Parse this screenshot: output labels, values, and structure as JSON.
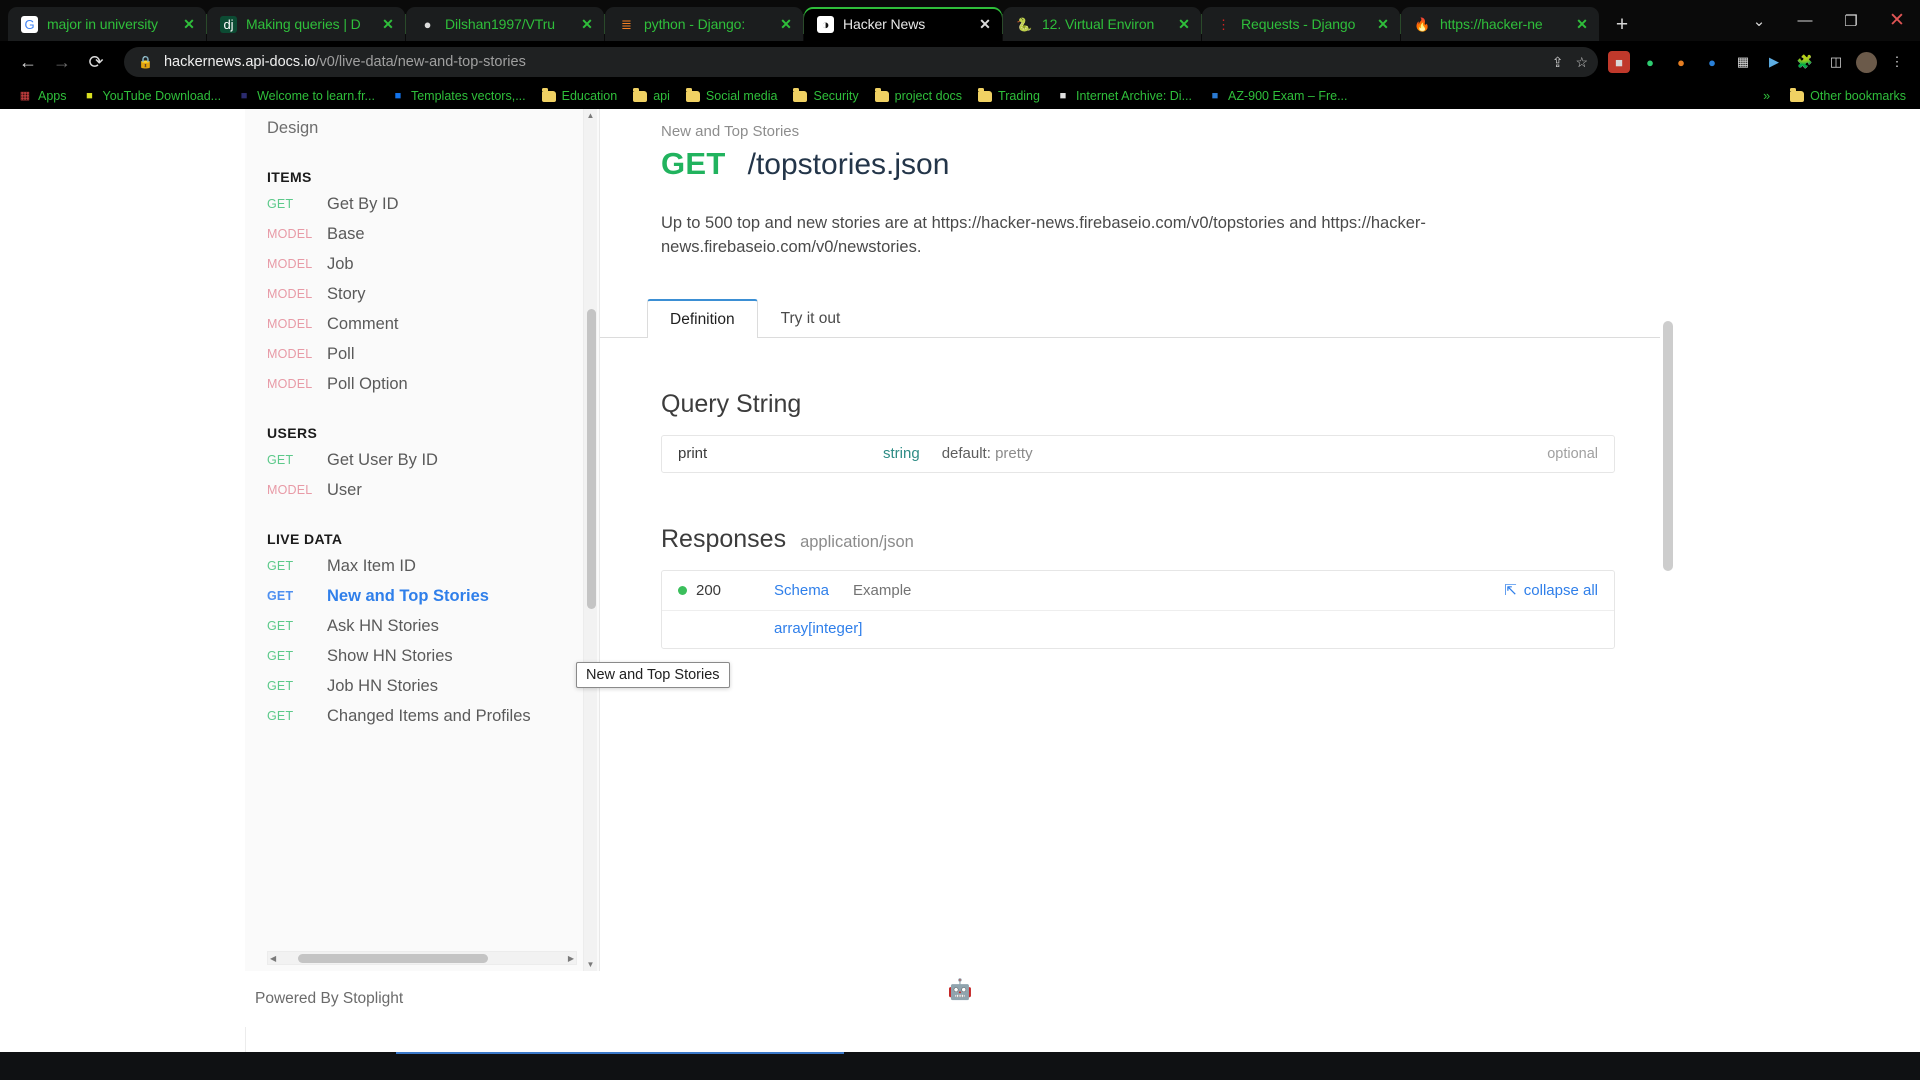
{
  "browser": {
    "tabs": [
      {
        "title": "major in university",
        "icon": "google-icon",
        "glyph": "G",
        "active": false
      },
      {
        "title": "Making queries | D",
        "icon": "django-icon",
        "glyph": "dj",
        "active": false
      },
      {
        "title": "Dilshan1997/VTru",
        "icon": "github-icon",
        "glyph": "●",
        "active": false
      },
      {
        "title": "python - Django:",
        "icon": "stackoverflow-icon",
        "glyph": "≣",
        "active": false
      },
      {
        "title": "Hacker News",
        "icon": "hackernews-icon",
        "glyph": "◑",
        "active": true
      },
      {
        "title": "12. Virtual Environ",
        "icon": "python-icon",
        "glyph": "🐍",
        "active": false
      },
      {
        "title": "Requests - Django",
        "icon": "dots-icon",
        "glyph": "⋮",
        "active": false
      },
      {
        "title": "https://hacker-ne",
        "icon": "firebase-icon",
        "glyph": "🔥",
        "active": false
      }
    ],
    "new_tab_label": "+",
    "window_controls": {
      "more": "⌄",
      "minimize": "—",
      "maximize": "❐",
      "close": "✕"
    },
    "nav": {
      "back": "←",
      "forward": "→",
      "reload": "⟳"
    },
    "omnibox": {
      "lock_icon": "lock-icon",
      "url_domain": "hackernews.api-docs.io",
      "url_path": "/v0/live-data/new-and-top-stories",
      "share_icon": "share-icon",
      "star_icon": "star-icon"
    },
    "toolbar_icons": [
      "extension-red-icon",
      "shield-green-icon",
      "orange-circle-icon",
      "blue-circle-icon",
      "qr-icon",
      "video-icon",
      "puzzle-icon",
      "sidebar-icon",
      "profile-avatar",
      "menu-icon"
    ],
    "bookmarks": {
      "apps_label": "Apps",
      "items": [
        {
          "label": "YouTube Download...",
          "icon": "youtube-icon"
        },
        {
          "label": "Welcome to learn.fr...",
          "icon": "code-icon"
        },
        {
          "label": "Templates vectors,...",
          "icon": "freepik-icon"
        },
        {
          "label": "Education",
          "icon": "folder-icon"
        },
        {
          "label": "api",
          "icon": "folder-icon"
        },
        {
          "label": "Social media",
          "icon": "folder-icon"
        },
        {
          "label": "Security",
          "icon": "folder-icon"
        },
        {
          "label": "project docs",
          "icon": "folder-icon"
        },
        {
          "label": "Trading",
          "icon": "folder-icon"
        },
        {
          "label": "Internet Archive: Di...",
          "icon": "archive-icon"
        },
        {
          "label": "AZ-900 Exam – Fre...",
          "icon": "blue-lines-icon"
        }
      ],
      "overflow_label": "»",
      "other_bookmarks_label": "Other bookmarks"
    }
  },
  "sidebar": {
    "top_item": "Design",
    "groups": [
      {
        "title": "ITEMS",
        "items": [
          {
            "verb": "GET",
            "label": "Get By ID",
            "active": false
          },
          {
            "verb": "MODEL",
            "label": "Base",
            "active": false
          },
          {
            "verb": "MODEL",
            "label": "Job",
            "active": false
          },
          {
            "verb": "MODEL",
            "label": "Story",
            "active": false
          },
          {
            "verb": "MODEL",
            "label": "Comment",
            "active": false
          },
          {
            "verb": "MODEL",
            "label": "Poll",
            "active": false
          },
          {
            "verb": "MODEL",
            "label": "Poll Option",
            "active": false
          }
        ]
      },
      {
        "title": "USERS",
        "items": [
          {
            "verb": "GET",
            "label": "Get User By ID",
            "active": false
          },
          {
            "verb": "MODEL",
            "label": "User",
            "active": false
          }
        ]
      },
      {
        "title": "LIVE DATA",
        "items": [
          {
            "verb": "GET",
            "label": "Max Item ID",
            "active": false
          },
          {
            "verb": "GET",
            "label": "New and Top Stories",
            "active": true
          },
          {
            "verb": "GET",
            "label": "Ask HN Stories",
            "active": false
          },
          {
            "verb": "GET",
            "label": "Show HN Stories",
            "active": false
          },
          {
            "verb": "GET",
            "label": "Job HN Stories",
            "active": false
          },
          {
            "verb": "GET",
            "label": "Changed Items and Profiles",
            "active": false
          }
        ]
      }
    ],
    "tooltip": "New and Top Stories"
  },
  "main": {
    "breadcrumb": "New and Top Stories",
    "method": "GET",
    "path": "/topstories.json",
    "description": "Up to 500 top and new stories are at https://hacker-news.firebaseio.com/v0/topstories and https://hacker-news.firebaseio.com/v0/newstories.",
    "tabs": [
      {
        "label": "Definition",
        "active": true
      },
      {
        "label": "Try it out",
        "active": false
      }
    ],
    "query_string": {
      "title": "Query String",
      "params": [
        {
          "name": "print",
          "type": "string",
          "default_label": "default:",
          "default_value": "pretty",
          "required_label": "optional"
        }
      ]
    },
    "responses": {
      "title": "Responses",
      "content_type": "application/json",
      "status_code": "200",
      "schema_tab": "Schema",
      "example_tab": "Example",
      "collapse_label": "collapse all",
      "collapse_icon": "collapse-icon",
      "body_type": "array[integer]"
    },
    "footer": "Powered By Stoplight",
    "robot_icon": "robot-icon"
  },
  "colors": {
    "get_green": "#21b35e",
    "model_pink": "#e89aa6",
    "link_blue": "#2f7fea",
    "path_navy": "#233549",
    "type_teal": "#2e8c85",
    "status_green": "#3bbf5c"
  }
}
